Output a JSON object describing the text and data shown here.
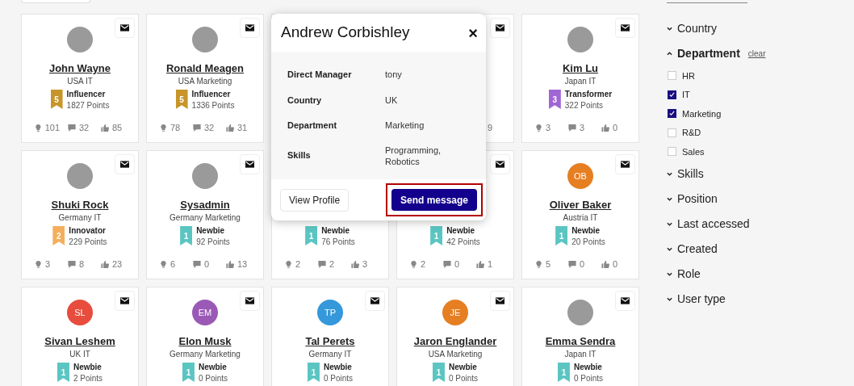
{
  "cards": [
    {
      "name": "John Wayne",
      "subtitle": "USA IT",
      "avatar": {
        "kind": "photo"
      },
      "mail": true,
      "badge": {
        "level": "5",
        "title": "Influencer",
        "points": "1827 Points",
        "color": "#c8952a"
      },
      "stats": {
        "ideas": "101",
        "comments": "32",
        "likes": "85"
      }
    },
    {
      "name": "Ronald Meagen",
      "subtitle": "USA Marketing",
      "avatar": {
        "kind": "photo"
      },
      "mail": true,
      "badge": {
        "level": "5",
        "title": "Influencer",
        "points": "1336 Points",
        "color": "#c8952a"
      },
      "stats": {
        "ideas": "78",
        "comments": "32",
        "likes": "31"
      }
    },
    {
      "mail": false
    },
    {
      "mail": true,
      "stats": {
        "likes": "9"
      }
    },
    {
      "name": "Kim Lu",
      "subtitle": "Japan IT",
      "avatar": {
        "kind": "photo"
      },
      "mail": true,
      "badge": {
        "level": "3",
        "title": "Transformer",
        "points": "322 Points",
        "color": "#a066d3"
      },
      "stats": {
        "ideas": "3",
        "comments": "3",
        "likes": "0"
      }
    },
    {
      "name": "Shuki Rock",
      "subtitle": "Germany IT",
      "avatar": {
        "kind": "photo"
      },
      "mail": true,
      "badge": {
        "level": "2",
        "title": "Innovator",
        "points": "229 Points",
        "color": "#f5ae5b"
      },
      "stats": {
        "ideas": "3",
        "comments": "8",
        "likes": "23"
      }
    },
    {
      "name": "Sysadmin",
      "subtitle": "Germany Marketing",
      "avatar": {
        "kind": "photo"
      },
      "mail": true,
      "badge": {
        "level": "1",
        "title": "Newbie",
        "points": "92 Points",
        "color": "#5bc5c2"
      },
      "stats": {
        "ideas": "6",
        "comments": "0",
        "likes": "13"
      }
    },
    {
      "mail": false,
      "badge": {
        "level": "1",
        "title": "Newbie",
        "points": "76 Points",
        "color": "#5bc5c2"
      },
      "stats": {
        "ideas": "2",
        "comments": "2",
        "likes": "3"
      }
    },
    {
      "mail": true,
      "badge": {
        "level": "1",
        "title": "Newbie",
        "points": "42 Points",
        "color": "#5bc5c2"
      },
      "stats": {
        "ideas": "2",
        "comments": "0",
        "likes": "1"
      }
    },
    {
      "name": "Oliver Baker",
      "subtitle": "Austria IT",
      "avatar": {
        "kind": "initials",
        "text": "OB",
        "color": "#e67e22"
      },
      "mail": true,
      "badge": {
        "level": "1",
        "title": "Newbie",
        "points": "20 Points",
        "color": "#5bc5c2"
      },
      "stats": {
        "ideas": "5",
        "comments": "0",
        "likes": "0"
      }
    },
    {
      "name": "Sivan Leshem",
      "subtitle": "UK IT",
      "avatar": {
        "kind": "initials",
        "text": "SL",
        "color": "#e74c3c"
      },
      "mail": true,
      "badge": {
        "level": "1",
        "title": "Newbie",
        "points": "2 Points",
        "color": "#5bc5c2"
      }
    },
    {
      "name": "Elon Musk",
      "subtitle": "Germany Marketing",
      "avatar": {
        "kind": "initials",
        "text": "EM",
        "color": "#9b59b6"
      },
      "mail": true,
      "badge": {
        "level": "1",
        "title": "Newbie",
        "points": "0 Points",
        "color": "#5bc5c2"
      }
    },
    {
      "name": "Tal Perets",
      "subtitle": "Germany IT",
      "avatar": {
        "kind": "initials",
        "text": "TP",
        "color": "#3498db"
      },
      "mail": true,
      "badge": {
        "level": "1",
        "title": "Newbie",
        "points": "0 Points",
        "color": "#5bc5c2"
      }
    },
    {
      "name": "Jaron Englander",
      "subtitle": "USA Marketing",
      "avatar": {
        "kind": "initials",
        "text": "JE",
        "color": "#e67e22"
      },
      "mail": true,
      "badge": {
        "level": "1",
        "title": "Newbie",
        "points": "0 Points",
        "color": "#5bc5c2"
      }
    },
    {
      "name": "Emma Sendra",
      "subtitle": "Japan IT",
      "avatar": {
        "kind": "photo"
      },
      "mail": true,
      "badge": {
        "level": "1",
        "title": "Newbie",
        "points": "0 Points",
        "color": "#5bc5c2"
      }
    }
  ],
  "profile_popup": {
    "title": "Andrew Corbishley",
    "close": "×",
    "fields": [
      {
        "label": "Direct Manager",
        "value": "tony"
      },
      {
        "label": "Country",
        "value": "UK"
      },
      {
        "label": "Department",
        "value": "Marketing"
      },
      {
        "label": "Skills",
        "value": "Programming, Robotics"
      }
    ],
    "buttons": [
      {
        "label": "View Profile",
        "kind": "secondary"
      },
      {
        "label": "Send message",
        "kind": "primary",
        "highlighted": true
      }
    ]
  },
  "filters": [
    {
      "label": "Country",
      "expanded": false
    },
    {
      "label": "Department",
      "expanded": true,
      "clear": "clear",
      "options": [
        {
          "label": "HR",
          "checked": false
        },
        {
          "label": "IT",
          "checked": true
        },
        {
          "label": "Marketing",
          "checked": true
        },
        {
          "label": "R&D",
          "checked": false
        },
        {
          "label": "Sales",
          "checked": false
        }
      ]
    },
    {
      "label": "Skills",
      "expanded": false
    },
    {
      "label": "Position",
      "expanded": false
    },
    {
      "label": "Last accessed",
      "expanded": false
    },
    {
      "label": "Created",
      "expanded": false
    },
    {
      "label": "Role",
      "expanded": false
    },
    {
      "label": "User type",
      "expanded": false
    }
  ]
}
